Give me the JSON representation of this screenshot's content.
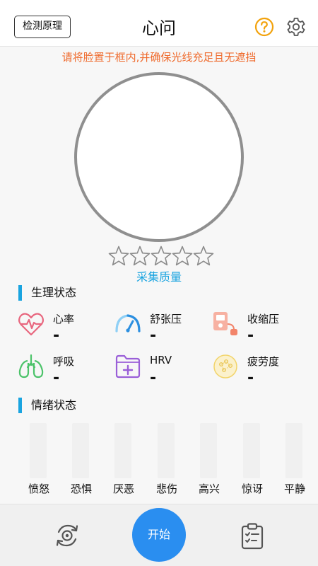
{
  "header": {
    "principle_button": "检测原理",
    "title": "心问",
    "help_icon": "question-circle-icon",
    "settings_icon": "gear-icon"
  },
  "hint": "请将脸置于框内,并确保光线充足且无遮挡",
  "quality": {
    "stars_filled": 0,
    "stars_total": 5,
    "label": "采集质量"
  },
  "physiology": {
    "title": "生理状态",
    "metrics": [
      {
        "label": "心率",
        "value": "-",
        "icon": "heart-rate-icon",
        "color": "#e8677f"
      },
      {
        "label": "舒张压",
        "value": "-",
        "icon": "gauge-icon",
        "color": "#3aa0e8"
      },
      {
        "label": "收缩压",
        "value": "-",
        "icon": "blood-pressure-monitor-icon",
        "color": "#f2846a"
      },
      {
        "label": "呼吸",
        "value": "-",
        "icon": "lungs-icon",
        "color": "#4cc36a"
      },
      {
        "label": "HRV",
        "value": "-",
        "icon": "folder-plus-icon",
        "color": "#9a5fd8"
      },
      {
        "label": "疲劳度",
        "value": "-",
        "icon": "fatigue-icon",
        "color": "#f2d46a"
      }
    ]
  },
  "emotions": {
    "title": "情绪状态",
    "items": [
      "愤怒",
      "恐惧",
      "厌恶",
      "悲伤",
      "高兴",
      "惊讶",
      "平静"
    ]
  },
  "bottom": {
    "switch_camera_icon": "switch-camera-icon",
    "start_label": "开始",
    "report_icon": "clipboard-check-icon"
  },
  "colors": {
    "accent": "#1aa4e0",
    "hint": "#ef6a2c",
    "start": "#2a8ef0"
  }
}
